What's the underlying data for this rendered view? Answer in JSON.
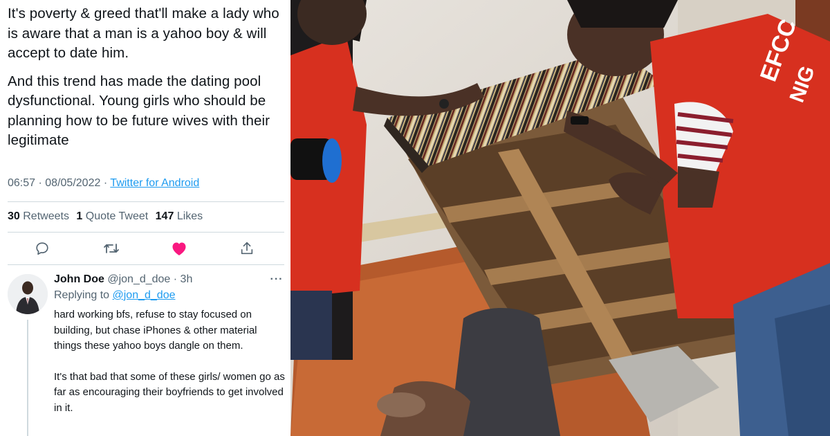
{
  "tweet": {
    "paragraphs": [
      "It's poverty & greed that'll make a lady who is aware that a man is a yahoo boy & will accept to date him.",
      "And this trend has made the dating pool dysfunctional. Young girls who should be planning how to be future wives with their legitimate"
    ],
    "time": "06:57",
    "date": "08/05/2022",
    "client": "Twitter for Android",
    "stats": {
      "retweets_count": "30",
      "retweets_label": "Retweets",
      "quotes_count": "1",
      "quotes_label": "Quote Tweet",
      "likes_count": "147",
      "likes_label": "Likes"
    },
    "actions": {
      "reply_icon": "comment-icon",
      "retweet_icon": "retweet-icon",
      "like_icon": "heart-filled-icon",
      "share_icon": "share-icon"
    },
    "colors": {
      "link": "#1d9bf0",
      "like": "#f91880",
      "muted": "#536471",
      "text": "#0f1419"
    }
  },
  "reply": {
    "name": "John Doe",
    "handle": "@jon_d_doe",
    "time": "3h",
    "replying_label": "Replying to",
    "replying_to": "@jon_d_doe",
    "paragraphs": [
      "hard working bfs, refuse to stay focused on building, but chase iPhones & other material things these yahoo boys dangle on them.",
      "It's that bad that some of these girls/ women go as far as encouraging their boyfriends to get involved in it."
    ]
  },
  "photo": {
    "vest_lettering": "EFCC NIGERIA",
    "description_icon": "photo-image"
  }
}
